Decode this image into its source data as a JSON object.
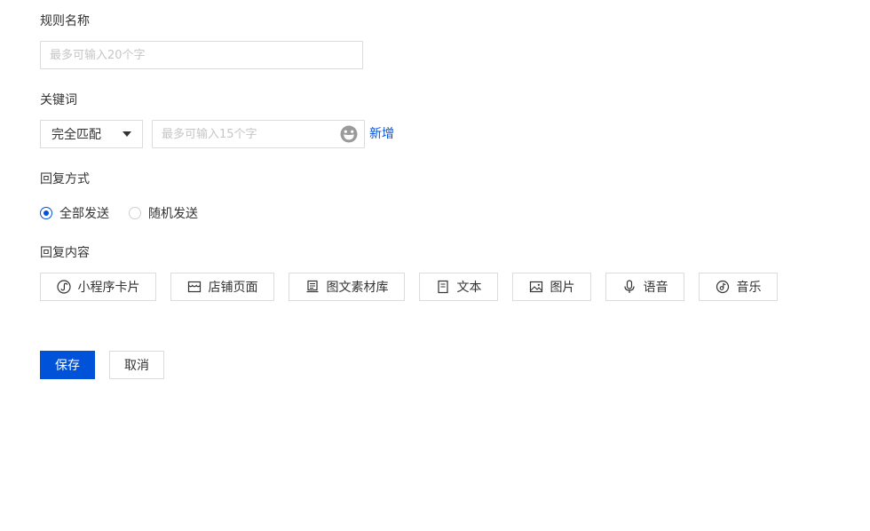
{
  "rule_name": {
    "label": "规则名称",
    "placeholder": "最多可输入20个字",
    "value": ""
  },
  "keyword": {
    "label": "关键词",
    "match_select": {
      "selected": "完全匹配"
    },
    "input_placeholder": "最多可输入15个字",
    "emoji_icon": "smiley-icon",
    "add_label": "新增"
  },
  "reply_mode": {
    "label": "回复方式",
    "options": [
      {
        "label": "全部发送",
        "selected": true
      },
      {
        "label": "随机发送",
        "selected": false
      }
    ]
  },
  "reply_content": {
    "label": "回复内容",
    "types": [
      {
        "label": "小程序卡片",
        "icon": "mini-program-icon"
      },
      {
        "label": "店铺页面",
        "icon": "store-page-icon"
      },
      {
        "label": "图文素材库",
        "icon": "material-library-icon"
      },
      {
        "label": "文本",
        "icon": "text-icon"
      },
      {
        "label": "图片",
        "icon": "image-icon"
      },
      {
        "label": "语音",
        "icon": "microphone-icon"
      },
      {
        "label": "音乐",
        "icon": "music-icon"
      }
    ]
  },
  "actions": {
    "save_label": "保存",
    "cancel_label": "取消"
  },
  "colors": {
    "primary": "#0052d9",
    "border": "#dcdcdc",
    "text": "#333333",
    "placeholder": "#c6c6c6"
  }
}
